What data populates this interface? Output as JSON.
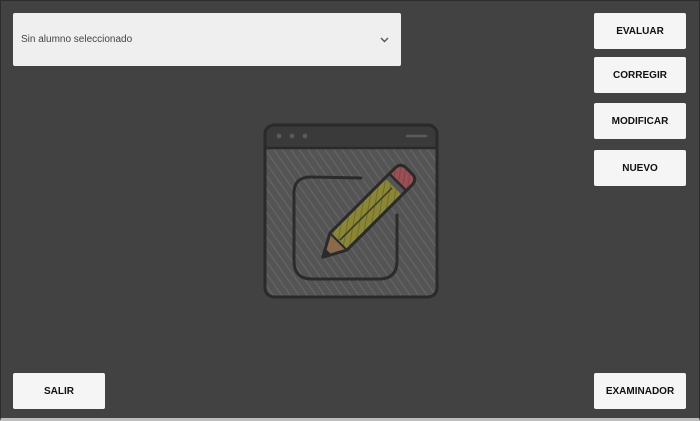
{
  "student_select": {
    "selected": "Sin alumno seleccionado",
    "icon": "chevron-down-icon"
  },
  "actions": {
    "evaluar": "EVALUAR",
    "corregir": "CORREGIR",
    "modificar": "MODIFICAR",
    "nuevo": "NUEVO",
    "salir": "SALIR",
    "examinador": "EXAMINADOR"
  },
  "illustration": {
    "icon": "edit-document-pencil-icon"
  },
  "colors": {
    "background": "#424242",
    "button": "#f5f5f5",
    "select": "#efefef"
  }
}
